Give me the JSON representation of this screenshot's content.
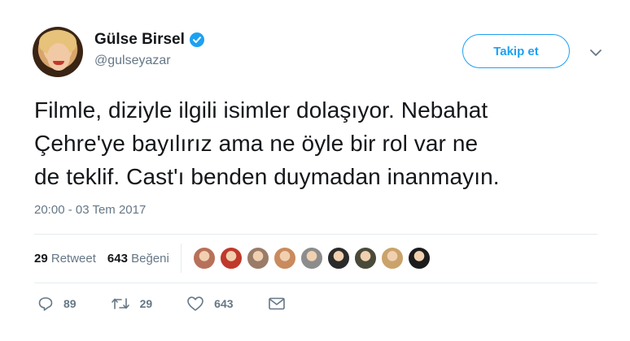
{
  "author": {
    "name": "Gülse Birsel",
    "handle": "@gulseyazar",
    "verified": true
  },
  "follow_button": {
    "label": "Takip et"
  },
  "tweet": {
    "lines": [
      "Filmle, diziyle ilgili isimler dolaşıyor. Nebahat",
      "Çehre'ye bayılırız ama ne öyle bir rol var ne",
      "de teklif. Cast'ı benden duymadan inanmayın."
    ]
  },
  "timestamp": "20:00 - 03 Tem 2017",
  "stats": {
    "retweets_count": "29",
    "retweets_label": "Retweet",
    "likes_count": "643",
    "likes_label": "Beğeni"
  },
  "liker_avatars": [
    {
      "color": "#b8705a"
    },
    {
      "color": "#c0392b"
    },
    {
      "color": "#9a7b68"
    },
    {
      "color": "#c98a5e"
    },
    {
      "color": "#8c8c8c"
    },
    {
      "color": "#2b2b2b"
    },
    {
      "color": "#4a4a3a"
    },
    {
      "color": "#c9a36a"
    },
    {
      "color": "#1c1c1c"
    }
  ],
  "actions": {
    "reply_count": "89",
    "retweet_count": "29",
    "like_count": "643"
  },
  "colors": {
    "accent": "#1da1f2",
    "text": "#14171a",
    "secondary": "#657786",
    "divider": "#e6ecf0"
  }
}
